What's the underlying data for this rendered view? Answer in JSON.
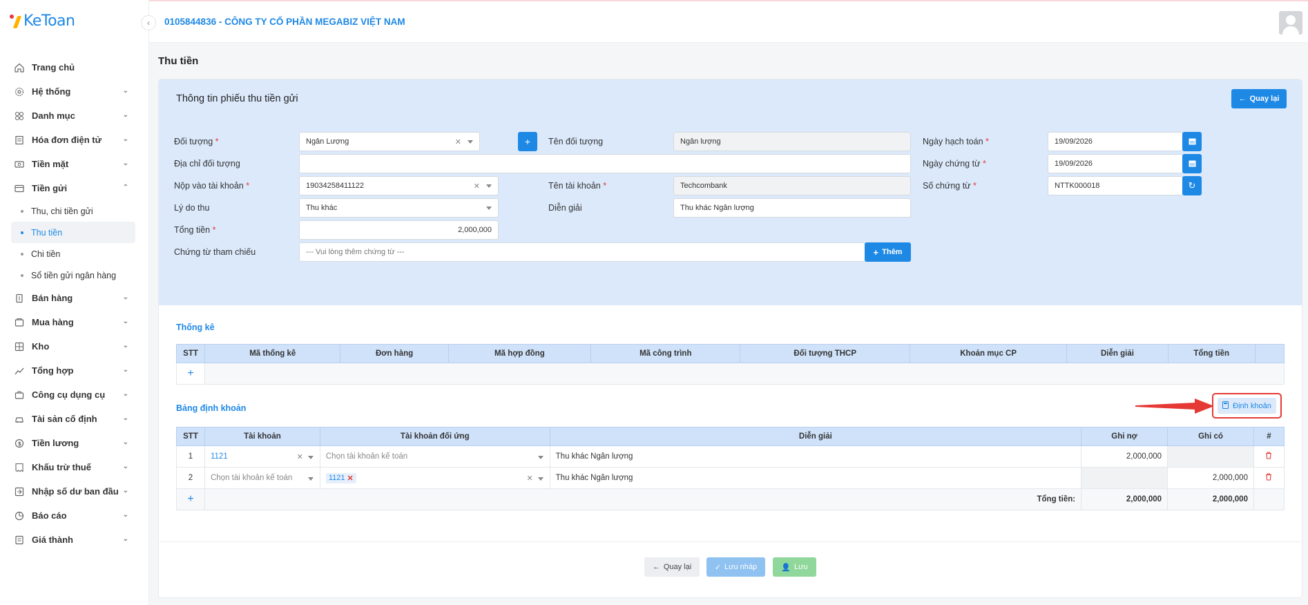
{
  "app": {
    "logo_text": "KeToan",
    "company": "0105844836 - CÔNG TY CỔ PHẦN MEGABIZ VIỆT NAM"
  },
  "sidebar": {
    "items": [
      {
        "label": "Trang chủ",
        "icon": "home-icon",
        "expandable": false
      },
      {
        "label": "Hệ thống",
        "icon": "gear-icon",
        "expandable": true
      },
      {
        "label": "Danh mục",
        "icon": "grid-icon",
        "expandable": true
      },
      {
        "label": "Hóa đơn điện tử",
        "icon": "invoice-icon",
        "expandable": true
      },
      {
        "label": "Tiền mặt",
        "icon": "cash-icon",
        "expandable": true
      },
      {
        "label": "Tiền gửi",
        "icon": "card-icon",
        "expandable": true,
        "expanded": true
      },
      {
        "label": "Bán hàng",
        "icon": "sell-icon",
        "expandable": true
      },
      {
        "label": "Mua hàng",
        "icon": "cart-icon",
        "expandable": true
      },
      {
        "label": "Kho",
        "icon": "warehouse-icon",
        "expandable": true
      },
      {
        "label": "Tổng hợp",
        "icon": "chart-icon",
        "expandable": true
      },
      {
        "label": "Công cụ dụng cụ",
        "icon": "tools-icon",
        "expandable": true
      },
      {
        "label": "Tài sản cố định",
        "icon": "car-icon",
        "expandable": true
      },
      {
        "label": "Tiền lương",
        "icon": "salary-icon",
        "expandable": true
      },
      {
        "label": "Khấu trừ thuế",
        "icon": "tax-icon",
        "expandable": true
      },
      {
        "label": "Nhập số dư ban đầu",
        "icon": "import-icon",
        "expandable": true
      },
      {
        "label": "Báo cáo",
        "icon": "report-icon",
        "expandable": true
      },
      {
        "label": "Giá thành",
        "icon": "price-icon",
        "expandable": true
      }
    ],
    "subitems": [
      {
        "label": "Thu, chi tiền gửi",
        "active": false
      },
      {
        "label": "Thu tiền",
        "active": true
      },
      {
        "label": "Chi tiền",
        "active": false
      },
      {
        "label": "Sổ tiền gửi ngân hàng",
        "active": false
      }
    ]
  },
  "page": {
    "title": "Thu tiền"
  },
  "card": {
    "title": "Thông tin phiếu thu tiền gửi",
    "back_label": "Quay lại"
  },
  "form": {
    "doi_tuong": {
      "label": "Đối tượng",
      "value": "Ngân Lượng"
    },
    "ten_doi_tuong": {
      "label": "Tên đối tượng",
      "value": "Ngân lượng"
    },
    "ngay_hach_toan": {
      "label": "Ngày hạch toán",
      "value": "19/09/2026"
    },
    "dia_chi": {
      "label": "Địa chỉ đối tượng",
      "value": ""
    },
    "ngay_chung_tu": {
      "label": "Ngày chứng từ",
      "value": "19/09/2026"
    },
    "nop_vao_tk": {
      "label": "Nộp vào tài khoản",
      "value": "19034258411122"
    },
    "ten_tk": {
      "label": "Tên tài khoản",
      "value": "Techcombank"
    },
    "so_chung_tu": {
      "label": "Số chứng từ",
      "value": "NTTK000018"
    },
    "ly_do_thu": {
      "label": "Lý do thu",
      "value": "Thu khác"
    },
    "dien_giai": {
      "label": "Diễn giải",
      "value": "Thu khác Ngân lượng"
    },
    "tong_tien": {
      "label": "Tổng tiền",
      "value": "2,000,000"
    },
    "chung_tu_tham_chieu": {
      "label": "Chứng từ tham chiếu",
      "placeholder": "--- Vui lòng thêm chứng từ ---",
      "add_label": "Thêm"
    }
  },
  "thong_ke": {
    "title": "Thống kê",
    "columns": [
      "STT",
      "Mã thống kê",
      "Đơn hàng",
      "Mã hợp đồng",
      "Mã công trình",
      "Đối tượng THCP",
      "Khoản mục CP",
      "Diễn giải",
      "Tổng tiền",
      ""
    ],
    "add": "+"
  },
  "dinh_khoan": {
    "title": "Bảng định khoản",
    "button_label": "Định khoản",
    "columns": [
      "STT",
      "Tài khoản",
      "Tài khoản đối ứng",
      "Diễn giải",
      "Ghi nợ",
      "Ghi có",
      "#"
    ],
    "rows": [
      {
        "stt": "1",
        "tai_khoan": "1121",
        "doi_ung": "Chọn tài khoản kế toán",
        "dien_giai": "Thu khác Ngân lượng",
        "ghi_no": "2,000,000",
        "ghi_co": ""
      },
      {
        "stt": "2",
        "tai_khoan": "Chọn tài khoản kế toán",
        "doi_ung": "1121",
        "dien_giai": "Thu khác Ngân lượng",
        "ghi_no": "",
        "ghi_co": "2,000,000"
      }
    ],
    "total_label": "Tổng tiền:",
    "total_no": "2,000,000",
    "total_co": "2,000,000",
    "add": "+"
  },
  "footer": {
    "back": "Quay lại",
    "draft": "Lưu nháp",
    "save": "Lưu"
  },
  "colors": {
    "accent": "#1e88e5",
    "danger": "#e53935",
    "success": "#66bb6a",
    "panel": "#dbe9fb"
  }
}
